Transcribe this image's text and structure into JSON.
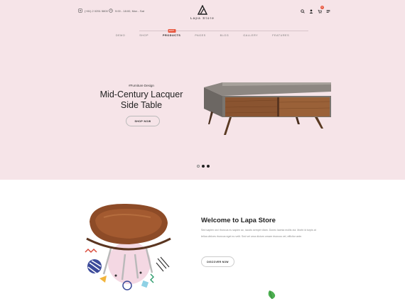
{
  "header": {
    "phone": "(+81) 2 0251 5800",
    "hours": "9:00 - 18:00, Mon - Sat",
    "logo_text": "Lapa Store",
    "cart_count": "0"
  },
  "nav": {
    "items": [
      "DEMO",
      "SHOP",
      "PRODUCTS",
      "PAGES",
      "BLOG",
      "GALLERY",
      "FEATURES"
    ],
    "active_index": 2,
    "hot_badge": "HOT"
  },
  "hero": {
    "eyebrow": "#Furniture Design",
    "title_line1": "Mid-Century Lacquer",
    "title_line2": "Side Table",
    "button": "SHOP NOW",
    "slide_count": 3,
    "active_slide": 1
  },
  "welcome": {
    "title": "Welcome to Lapa Store",
    "body": "Sed sapien orci rhoncus eu sapien ac, iaculis semper diam. Donec lacinia mollis dui. Morbi id turpis at tellus ultrices rhoncus eget eu velit. Sed vel urna dictum ornare rhoncus vel, efficitur ante.",
    "button": "DISCOVER NOW"
  },
  "colors": {
    "hero_bg": "#f6e4e8",
    "accent": "#e8573f"
  }
}
